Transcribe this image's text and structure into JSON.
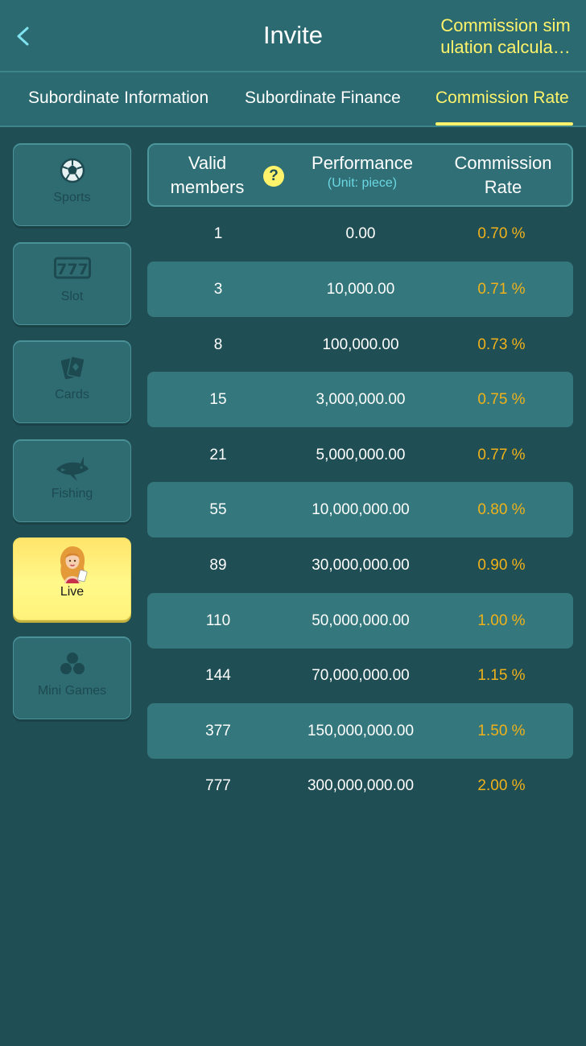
{
  "header": {
    "title": "Invite",
    "calculator_link_line1": "Commission sim",
    "calculator_link_line2": "ulation calcula…"
  },
  "tabs": [
    {
      "label": "Subordinate Information"
    },
    {
      "label": "Subordinate Finance"
    },
    {
      "label": "Commission Rate",
      "active": true
    }
  ],
  "categories": [
    {
      "label": "Sports",
      "icon": "soccer-ball-icon"
    },
    {
      "label": "Slot",
      "icon": "slot-777-icon"
    },
    {
      "label": "Cards",
      "icon": "playing-cards-icon"
    },
    {
      "label": "Fishing",
      "icon": "shark-icon"
    },
    {
      "label": "Live",
      "icon": "live-dealer-avatar-icon",
      "active": true
    },
    {
      "label": "Mini Games",
      "icon": "mini-games-icon"
    }
  ],
  "table": {
    "headers": {
      "members": "Valid members",
      "performance": "Performance",
      "performance_unit": "(Unit: piece)",
      "rate": "Commission Rate"
    },
    "help_symbol": "?",
    "rows": [
      {
        "members": "1",
        "performance": "0.00",
        "rate": "0.70 %"
      },
      {
        "members": "3",
        "performance": "10,000.00",
        "rate": "0.71 %"
      },
      {
        "members": "8",
        "performance": "100,000.00",
        "rate": "0.73 %"
      },
      {
        "members": "15",
        "performance": "3,000,000.00",
        "rate": "0.75 %"
      },
      {
        "members": "21",
        "performance": "5,000,000.00",
        "rate": "0.77 %"
      },
      {
        "members": "55",
        "performance": "10,000,000.00",
        "rate": "0.80 %"
      },
      {
        "members": "89",
        "performance": "30,000,000.00",
        "rate": "0.90 %"
      },
      {
        "members": "110",
        "performance": "50,000,000.00",
        "rate": "1.00 %"
      },
      {
        "members": "144",
        "performance": "70,000,000.00",
        "rate": "1.15 %"
      },
      {
        "members": "377",
        "performance": "150,000,000.00",
        "rate": "1.50 %"
      },
      {
        "members": "777",
        "performance": "300,000,000.00",
        "rate": "2.00 %"
      }
    ]
  },
  "colors": {
    "background": "#1f4e55",
    "header": "#2b6a70",
    "accent_yellow": "#fff36b",
    "rate_orange": "#f0b21a",
    "unit_cyan": "#6cd8e4"
  }
}
